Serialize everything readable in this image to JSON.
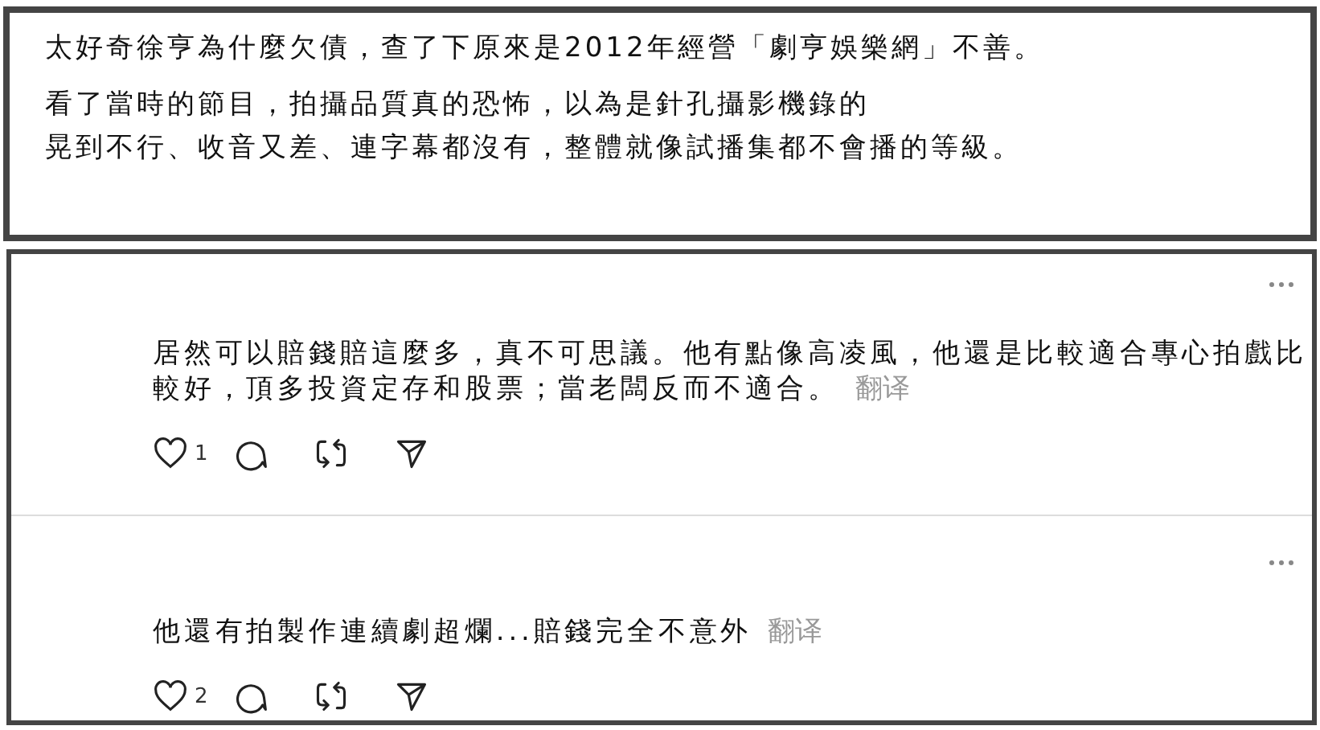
{
  "quote": {
    "paragraphs": [
      {
        "lines": [
          "太好奇徐亨為什麼欠債，查了下原來是2012年經營「劇亨娛樂網」不善。"
        ]
      },
      {
        "lines": [
          "看了當時的節目，拍攝品質真的恐怖，以為是針孔攝影機錄的",
          "晃到不行、收音又差、連字幕都沒有，整體就像試播集都不會播的等級。"
        ]
      }
    ]
  },
  "comments": [
    {
      "text": "居然可以賠錢賠這麼多，真不可思議。他有點像高凌風，他還是比較適合專心拍戲比較好，頂多投資定存和股票；當老闆反而不適合。",
      "translate": "翻译",
      "likes": "1"
    },
    {
      "text": "他還有拍製作連續劇超爛...賠錢完全不意外",
      "translate": "翻译",
      "likes": "2"
    }
  ]
}
